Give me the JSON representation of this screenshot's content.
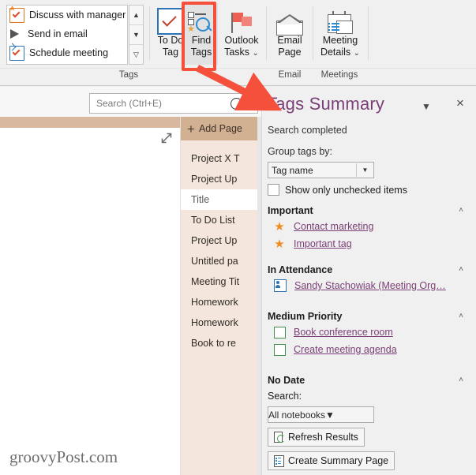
{
  "ribbon": {
    "tag_gallery": {
      "items": [
        {
          "label": "Discuss with manager",
          "icon": "discuss-tag-icon"
        },
        {
          "label": "Send in email",
          "icon": "send-email-tag-icon"
        },
        {
          "label": "Schedule meeting",
          "icon": "schedule-meeting-tag-icon"
        }
      ],
      "scroll_up": "▲",
      "scroll_down": "▼",
      "more": "▼"
    },
    "buttons": {
      "to_do_tag": {
        "line1": "To Do",
        "line2": "Tag"
      },
      "find_tags": {
        "line1": "Find",
        "line2": "Tags"
      },
      "outlook_tasks": {
        "line1": "Outlook",
        "line2": "Tasks",
        "caret": "⌄"
      },
      "email_page": {
        "line1": "Email",
        "line2": "Page"
      },
      "meeting_details": {
        "line1": "Meeting",
        "line2": "Details",
        "caret": "⌄"
      }
    },
    "groups": [
      {
        "label": "Tags"
      },
      {
        "label": "Email"
      },
      {
        "label": "Meetings"
      }
    ],
    "collapse_caret": "˄"
  },
  "search": {
    "placeholder": "Search (Ctrl+E)",
    "dropdown_caret": "▼"
  },
  "pagelist": {
    "add_page": "Add Page",
    "add_icon": "+",
    "pages": [
      {
        "title": "Project X T",
        "selected": false
      },
      {
        "title": "Project Up",
        "selected": false
      },
      {
        "title": "Title",
        "selected": true
      },
      {
        "title": "To Do List",
        "selected": false
      },
      {
        "title": "Project Up",
        "selected": false
      },
      {
        "title": "Untitled pa",
        "selected": false
      },
      {
        "title": "Meeting Tit",
        "selected": false
      },
      {
        "title": "Homework",
        "selected": false
      },
      {
        "title": "Homework",
        "selected": false
      },
      {
        "title": "Book to re",
        "selected": false
      }
    ]
  },
  "canvas": {
    "watermark": "groovyPost.com",
    "expand_icon": "expand-arrow-icon"
  },
  "pane": {
    "title": "Tags Summary",
    "dropdown_caret": "▼",
    "close": "×",
    "status": "Search completed",
    "group_label": "Group tags by:",
    "group_value": "Tag name",
    "group_caret": "▼",
    "show_unchecked_label": "Show only unchecked items",
    "sections": [
      {
        "heading": "Important",
        "collapse_caret": "˄",
        "items": [
          {
            "label": "Contact marketing",
            "icon": "star-icon"
          },
          {
            "label": "Important tag",
            "icon": "star-icon"
          }
        ]
      },
      {
        "heading": "In Attendance",
        "collapse_caret": "˄",
        "items": [
          {
            "label": "Sandy Stachowiak (Meeting Org…",
            "icon": "person-tag-icon"
          }
        ]
      },
      {
        "heading": "Medium Priority",
        "collapse_caret": "˄",
        "items": [
          {
            "label": "Book conference room",
            "icon": "checkbox-icon"
          },
          {
            "label": "Create meeting agenda",
            "icon": "checkbox-icon"
          }
        ]
      },
      {
        "heading": "No Date",
        "collapse_caret": "˄",
        "items": []
      }
    ],
    "search_label": "Search:",
    "notebook_scope": "All notebooks",
    "notebook_caret": "▼",
    "refresh_button": "Refresh Results",
    "summary_button": "Create Summary Page"
  },
  "colors": {
    "accent_purple": "#7b3f77",
    "annotation_red": "#f4503c",
    "page_list_bg": "#f4e6dc",
    "add_page_bg": "#d2b193",
    "star_orange": "#ef8d21",
    "check_green": "#3f8f4f",
    "blue": "#2e75b6"
  }
}
